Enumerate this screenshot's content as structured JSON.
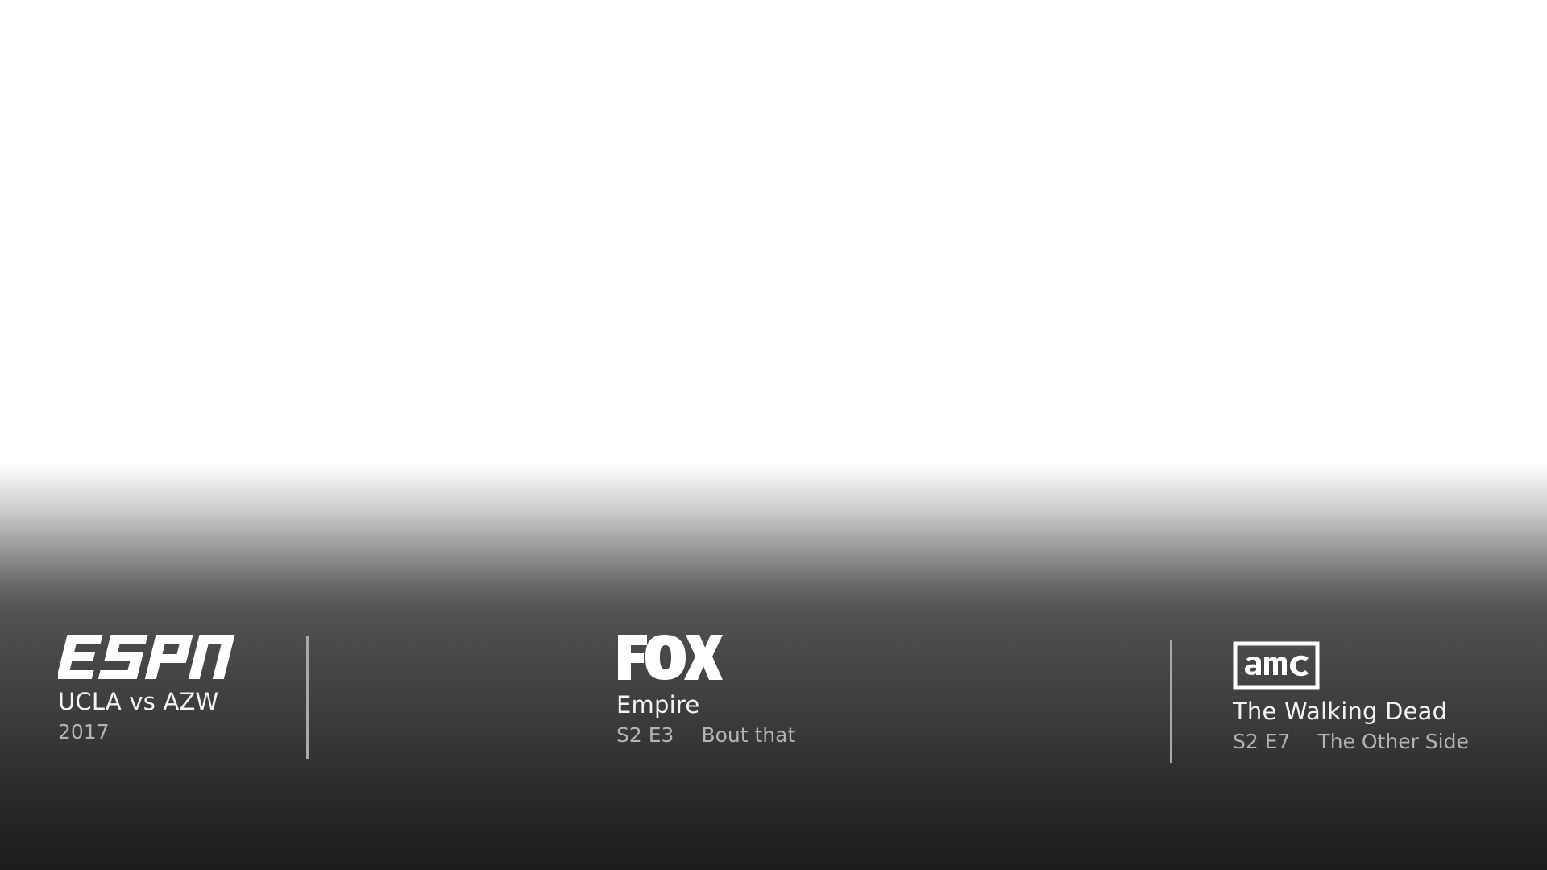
{
  "channels": [
    {
      "network": "ESPN",
      "title": "UCLA vs AZW",
      "year": "2017"
    },
    {
      "network": "FOX",
      "title": "Empire",
      "episode": "S2 E3",
      "episode_title": "Bout that"
    },
    {
      "network": "AMC",
      "title": "The Walking Dead",
      "episode": "S2 E7",
      "episode_title": "The Other Side"
    }
  ],
  "colors": {
    "background_top": "#ffffff",
    "background_bottom": "#1c1c1c",
    "title_text": "#f4f4f4",
    "meta_text": "#b4b4b4",
    "divider": "#a9a9a9"
  }
}
